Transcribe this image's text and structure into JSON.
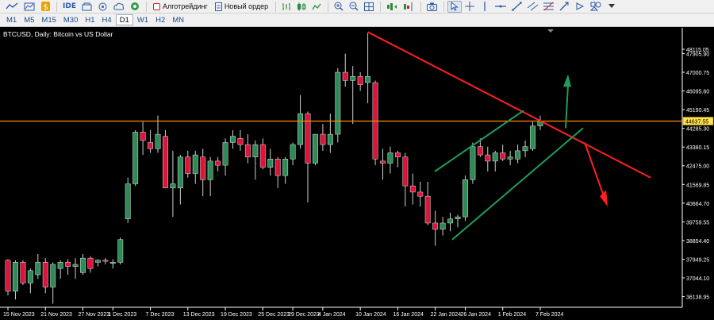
{
  "toolbar": {
    "items": [
      {
        "icon": "line-tool-icon"
      },
      {
        "icon": "chart-type-icon"
      },
      {
        "icon": "dollar-icon"
      },
      {
        "label": "IDE"
      },
      {
        "icon": "market-icon"
      },
      {
        "icon": "signals-icon"
      },
      {
        "icon": "cloud-icon"
      },
      {
        "icon": "vps-icon"
      }
    ],
    "algotrading_label": "Алготрейдинг",
    "new_order_label": "Новый ордер"
  },
  "timeframes": [
    "M1",
    "M5",
    "M15",
    "M30",
    "H1",
    "H4",
    "D1",
    "W1",
    "H2",
    "MN"
  ],
  "active_timeframe": "D1",
  "symbol_title": "BTCUSD, Daily: Bitcoin vs US Dollar",
  "colors": {
    "background": "#000000",
    "bull": "#2e8b57",
    "bear": "#dc143c",
    "grid_text": "#ffffff",
    "horizontal_level": "#ff8c00",
    "trendline_red": "#ff2020",
    "channel_green": "#1e9e5a"
  },
  "chart_data": {
    "type": "candlestick",
    "symbol": "BTCUSD",
    "timeframe": "Daily",
    "y_ticks": [
      "48115.05",
      "47905.90",
      "47000.75",
      "46095.60",
      "45190.45",
      "44285.30",
      "43380.15",
      "42475.00",
      "41569.85",
      "40664.70",
      "39759.55",
      "38854.40",
      "37949.25",
      "37044.10",
      "36138.95"
    ],
    "x_ticks": [
      "15 Nov 2023",
      "21 Nov 2023",
      "27 Nov 2023",
      "1 Dec 2023",
      "7 Dec 2023",
      "13 Dec 2023",
      "19 Dec 2023",
      "25 Dec 2023",
      "29 Dec 2023",
      "4 Jan 2024",
      "10 Jan 2024",
      "16 Jan 2024",
      "22 Jan 2024",
      "26 Jan 2024",
      "1 Feb 2024",
      "7 Feb 2024"
    ],
    "current_price": "44637.55",
    "horizontal_level": 44637.55,
    "ylim": [
      35700,
      49000
    ],
    "candles": [
      {
        "o": 37900,
        "h": 37950,
        "l": 36200,
        "c": 36400
      },
      {
        "o": 36400,
        "h": 37900,
        "l": 36000,
        "c": 37800
      },
      {
        "o": 37800,
        "h": 37900,
        "l": 36700,
        "c": 36800
      },
      {
        "o": 36800,
        "h": 37500,
        "l": 36300,
        "c": 37400
      },
      {
        "o": 37200,
        "h": 38200,
        "l": 37000,
        "c": 37800
      },
      {
        "o": 37800,
        "h": 38000,
        "l": 36300,
        "c": 36600
      },
      {
        "o": 36600,
        "h": 37800,
        "l": 35800,
        "c": 37700
      },
      {
        "o": 37500,
        "h": 37900,
        "l": 37000,
        "c": 37800
      },
      {
        "o": 37800,
        "h": 37950,
        "l": 37200,
        "c": 37600
      },
      {
        "o": 37600,
        "h": 38000,
        "l": 37000,
        "c": 37700
      },
      {
        "o": 37300,
        "h": 38200,
        "l": 37200,
        "c": 38000
      },
      {
        "o": 38000,
        "h": 38100,
        "l": 37300,
        "c": 37500
      },
      {
        "o": 37800,
        "h": 37950,
        "l": 37600,
        "c": 37900
      },
      {
        "o": 37900,
        "h": 38000,
        "l": 37700,
        "c": 37850
      },
      {
        "o": 37750,
        "h": 37950,
        "l": 37500,
        "c": 37800
      },
      {
        "o": 37800,
        "h": 39000,
        "l": 37700,
        "c": 38900
      },
      {
        "o": 39900,
        "h": 41900,
        "l": 39700,
        "c": 41600
      },
      {
        "o": 41600,
        "h": 44200,
        "l": 41500,
        "c": 44100
      },
      {
        "o": 44100,
        "h": 44600,
        "l": 43000,
        "c": 43700
      },
      {
        "o": 43600,
        "h": 44200,
        "l": 43100,
        "c": 43300
      },
      {
        "o": 43300,
        "h": 44900,
        "l": 43100,
        "c": 44000
      },
      {
        "o": 43900,
        "h": 44200,
        "l": 41400,
        "c": 41400
      },
      {
        "o": 41400,
        "h": 43200,
        "l": 40000,
        "c": 41600
      },
      {
        "o": 41400,
        "h": 43000,
        "l": 40600,
        "c": 42900
      },
      {
        "o": 42900,
        "h": 43200,
        "l": 41900,
        "c": 42100
      },
      {
        "o": 42100,
        "h": 43200,
        "l": 41600,
        "c": 43000
      },
      {
        "o": 42900,
        "h": 43300,
        "l": 41000,
        "c": 41800
      },
      {
        "o": 41800,
        "h": 42900,
        "l": 41000,
        "c": 42700
      },
      {
        "o": 42700,
        "h": 42900,
        "l": 42200,
        "c": 42500
      },
      {
        "o": 42500,
        "h": 43800,
        "l": 42000,
        "c": 43600
      },
      {
        "o": 43600,
        "h": 44200,
        "l": 43300,
        "c": 43900
      },
      {
        "o": 43800,
        "h": 44200,
        "l": 43200,
        "c": 43500
      },
      {
        "o": 43500,
        "h": 44000,
        "l": 42600,
        "c": 42900
      },
      {
        "o": 42900,
        "h": 43700,
        "l": 41800,
        "c": 43500
      },
      {
        "o": 43500,
        "h": 43800,
        "l": 42300,
        "c": 42400
      },
      {
        "o": 42400,
        "h": 43300,
        "l": 42000,
        "c": 42800
      },
      {
        "o": 42800,
        "h": 42900,
        "l": 41400,
        "c": 42000
      },
      {
        "o": 42000,
        "h": 42900,
        "l": 41600,
        "c": 42800
      },
      {
        "o": 42800,
        "h": 43600,
        "l": 42500,
        "c": 43500
      },
      {
        "o": 43500,
        "h": 45900,
        "l": 43300,
        "c": 45000
      },
      {
        "o": 45000,
        "h": 45100,
        "l": 40700,
        "c": 42600
      },
      {
        "o": 42600,
        "h": 44000,
        "l": 42500,
        "c": 44000
      },
      {
        "o": 44000,
        "h": 44500,
        "l": 43200,
        "c": 43500
      },
      {
        "o": 43500,
        "h": 45000,
        "l": 43100,
        "c": 44000
      },
      {
        "o": 44000,
        "h": 47200,
        "l": 43600,
        "c": 47000
      },
      {
        "o": 47000,
        "h": 47900,
        "l": 46300,
        "c": 46600
      },
      {
        "o": 46600,
        "h": 47300,
        "l": 44500,
        "c": 46800
      },
      {
        "o": 46800,
        "h": 47000,
        "l": 46100,
        "c": 46400
      },
      {
        "o": 46500,
        "h": 48900,
        "l": 45500,
        "c": 46800
      },
      {
        "o": 46500,
        "h": 46600,
        "l": 42500,
        "c": 42800
      },
      {
        "o": 42700,
        "h": 43300,
        "l": 41800,
        "c": 42600
      },
      {
        "o": 42600,
        "h": 43400,
        "l": 42100,
        "c": 43100
      },
      {
        "o": 43100,
        "h": 43200,
        "l": 42400,
        "c": 42900
      },
      {
        "o": 42900,
        "h": 43100,
        "l": 40500,
        "c": 41500
      },
      {
        "o": 41500,
        "h": 42100,
        "l": 40600,
        "c": 41200
      },
      {
        "o": 41200,
        "h": 41700,
        "l": 40500,
        "c": 41000
      },
      {
        "o": 41000,
        "h": 41700,
        "l": 39600,
        "c": 39700
      },
      {
        "o": 39700,
        "h": 40300,
        "l": 38600,
        "c": 39400
      },
      {
        "o": 39400,
        "h": 40000,
        "l": 39100,
        "c": 39700
      },
      {
        "o": 39700,
        "h": 40200,
        "l": 39300,
        "c": 39900
      },
      {
        "o": 39900,
        "h": 40100,
        "l": 39500,
        "c": 40000
      },
      {
        "o": 40000,
        "h": 42000,
        "l": 39800,
        "c": 41800
      },
      {
        "o": 41800,
        "h": 43600,
        "l": 41600,
        "c": 43400
      },
      {
        "o": 43400,
        "h": 43800,
        "l": 42900,
        "c": 43000
      },
      {
        "o": 43000,
        "h": 43400,
        "l": 42200,
        "c": 42700
      },
      {
        "o": 42700,
        "h": 43200,
        "l": 42200,
        "c": 43100
      },
      {
        "o": 43100,
        "h": 43500,
        "l": 42700,
        "c": 42800
      },
      {
        "o": 42800,
        "h": 43200,
        "l": 42500,
        "c": 42900
      },
      {
        "o": 42800,
        "h": 43500,
        "l": 42600,
        "c": 43200
      },
      {
        "o": 43200,
        "h": 43700,
        "l": 42900,
        "c": 43400
      },
      {
        "o": 43300,
        "h": 44600,
        "l": 43200,
        "c": 44400
      },
      {
        "o": 44400,
        "h": 44900,
        "l": 44200,
        "c": 44637
      }
    ]
  }
}
